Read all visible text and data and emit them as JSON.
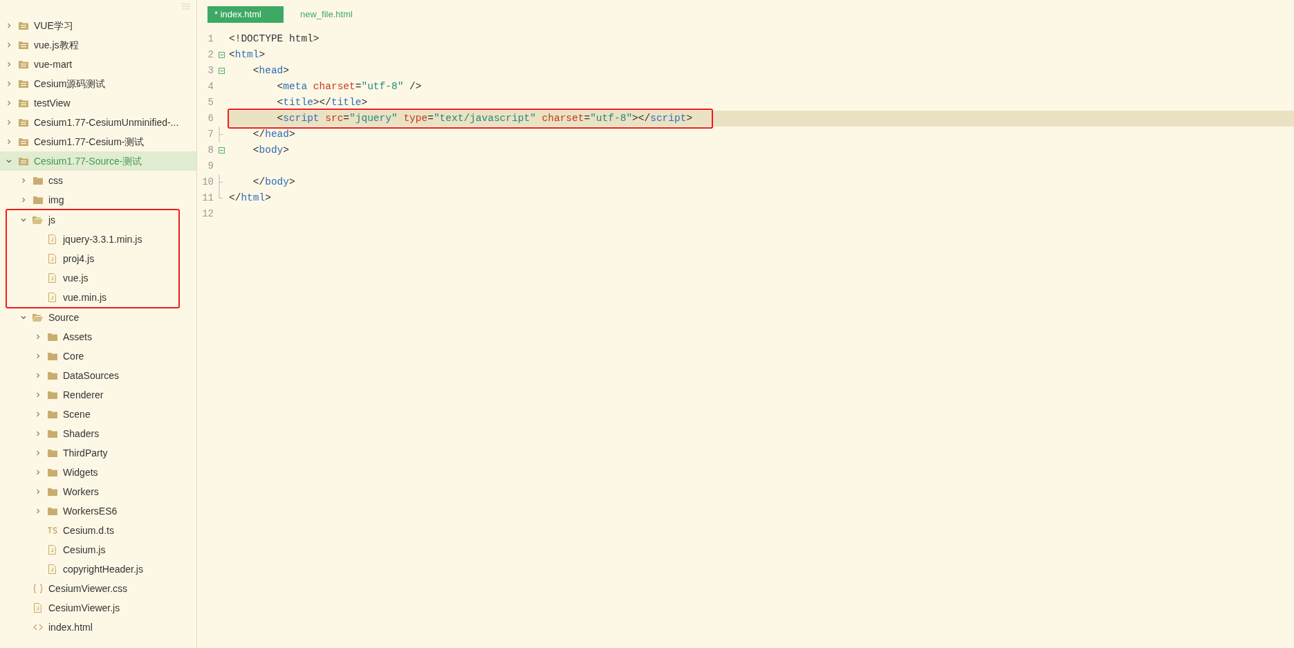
{
  "sidebar": {
    "tree": [
      {
        "label": "VUE学习",
        "kind": "project",
        "expanded": false,
        "selected": false
      },
      {
        "label": "vue.js教程",
        "kind": "project",
        "expanded": false,
        "selected": false
      },
      {
        "label": "vue-mart",
        "kind": "project",
        "expanded": false,
        "selected": false
      },
      {
        "label": "Cesium源码测试",
        "kind": "project",
        "expanded": false,
        "selected": false
      },
      {
        "label": "testView",
        "kind": "project",
        "expanded": false,
        "selected": false
      },
      {
        "label": "Cesium1.77-CesiumUnminified-...",
        "kind": "project",
        "expanded": false,
        "selected": false
      },
      {
        "label": "Cesium1.77-Cesium-测试",
        "kind": "project",
        "expanded": false,
        "selected": false
      },
      {
        "label": "Cesium1.77-Source-测试",
        "kind": "project",
        "expanded": true,
        "selected": true,
        "children": [
          {
            "label": "css",
            "kind": "folder",
            "expanded": false,
            "selected": false
          },
          {
            "label": "img",
            "kind": "folder",
            "expanded": false,
            "selected": false
          },
          {
            "label": "js",
            "kind": "folder",
            "expanded": true,
            "selected": false,
            "boxed": true,
            "children": [
              {
                "label": "jquery-3.3.1.min.js",
                "kind": "js",
                "selected": false
              },
              {
                "label": "proj4.js",
                "kind": "js",
                "selected": false
              },
              {
                "label": "vue.js",
                "kind": "js",
                "selected": false
              },
              {
                "label": "vue.min.js",
                "kind": "js",
                "selected": false
              }
            ]
          },
          {
            "label": "Source",
            "kind": "folder",
            "expanded": true,
            "selected": false,
            "children": [
              {
                "label": "Assets",
                "kind": "folder",
                "expanded": false,
                "selected": false
              },
              {
                "label": "Core",
                "kind": "folder",
                "expanded": false,
                "selected": false
              },
              {
                "label": "DataSources",
                "kind": "folder",
                "expanded": false,
                "selected": false
              },
              {
                "label": "Renderer",
                "kind": "folder",
                "expanded": false,
                "selected": false
              },
              {
                "label": "Scene",
                "kind": "folder",
                "expanded": false,
                "selected": false
              },
              {
                "label": "Shaders",
                "kind": "folder",
                "expanded": false,
                "selected": false
              },
              {
                "label": "ThirdParty",
                "kind": "folder",
                "expanded": false,
                "selected": false
              },
              {
                "label": "Widgets",
                "kind": "folder",
                "expanded": false,
                "selected": false
              },
              {
                "label": "Workers",
                "kind": "folder",
                "expanded": false,
                "selected": false
              },
              {
                "label": "WorkersES6",
                "kind": "folder",
                "expanded": false,
                "selected": false
              },
              {
                "label": "Cesium.d.ts",
                "kind": "ts",
                "selected": false
              },
              {
                "label": "Cesium.js",
                "kind": "js",
                "selected": false
              },
              {
                "label": "copyrightHeader.js",
                "kind": "js",
                "selected": false
              }
            ]
          },
          {
            "label": "CesiumViewer.css",
            "kind": "css",
            "selected": false
          },
          {
            "label": "CesiumViewer.js",
            "kind": "js",
            "selected": false
          },
          {
            "label": "index.html",
            "kind": "html",
            "selected": false
          }
        ]
      }
    ]
  },
  "tabs": [
    {
      "label": "* index.html",
      "selected": true
    },
    {
      "label": "new_file.html",
      "selected": false
    }
  ],
  "editor": {
    "lines": [
      {
        "number": "1",
        "tokens": [
          {
            "kind": "punct",
            "text": "<!DOCTYPE html>"
          }
        ]
      },
      {
        "number": "2",
        "fold_start": true,
        "tokens": [
          {
            "kind": "punct",
            "text": "<"
          },
          {
            "kind": "tag",
            "text": "html"
          },
          {
            "kind": "punct",
            "text": ">"
          }
        ]
      },
      {
        "number": "3",
        "fold_start": true,
        "tokens": [
          {
            "kind": "punct",
            "text": "    <"
          },
          {
            "kind": "tag",
            "text": "head"
          },
          {
            "kind": "punct",
            "text": ">"
          }
        ]
      },
      {
        "number": "4",
        "tokens": [
          {
            "kind": "punct",
            "text": "        <"
          },
          {
            "kind": "tag",
            "text": "meta"
          },
          {
            "kind": "attr",
            "text": " charset"
          },
          {
            "kind": "punct",
            "text": "="
          },
          {
            "kind": "string",
            "text": "\"utf-8\""
          },
          {
            "kind": "punct",
            "text": " />"
          }
        ]
      },
      {
        "number": "5",
        "tokens": [
          {
            "kind": "punct",
            "text": "        <"
          },
          {
            "kind": "tag",
            "text": "title"
          },
          {
            "kind": "punct",
            "text": "></"
          },
          {
            "kind": "tag",
            "text": "title"
          },
          {
            "kind": "punct",
            "text": ">"
          }
        ]
      },
      {
        "number": "6",
        "current": true,
        "boxed": true,
        "tokens": [
          {
            "kind": "punct",
            "text": "        <"
          },
          {
            "kind": "tag",
            "text": "script"
          },
          {
            "kind": "attr",
            "text": " src"
          },
          {
            "kind": "punct",
            "text": "="
          },
          {
            "kind": "string",
            "text": "\"jquery\""
          },
          {
            "kind": "attr",
            "text": " type"
          },
          {
            "kind": "punct",
            "text": "="
          },
          {
            "kind": "string",
            "text": "\"text/javascript\""
          },
          {
            "kind": "attr",
            "text": " charset"
          },
          {
            "kind": "punct",
            "text": "="
          },
          {
            "kind": "string",
            "text": "\"utf-8\""
          },
          {
            "kind": "punct",
            "text": "></"
          },
          {
            "kind": "tag",
            "text": "script"
          },
          {
            "kind": "punct",
            "text": ">"
          }
        ]
      },
      {
        "number": "7",
        "fold_end": true,
        "tokens": [
          {
            "kind": "punct",
            "text": "    </"
          },
          {
            "kind": "tag",
            "text": "head"
          },
          {
            "kind": "punct",
            "text": ">"
          }
        ]
      },
      {
        "number": "8",
        "fold_start": true,
        "tokens": [
          {
            "kind": "punct",
            "text": "    <"
          },
          {
            "kind": "tag",
            "text": "body"
          },
          {
            "kind": "punct",
            "text": ">"
          }
        ]
      },
      {
        "number": "9"
      },
      {
        "number": "10",
        "fold_end": true,
        "tokens": [
          {
            "kind": "punct",
            "text": "    </"
          },
          {
            "kind": "tag",
            "text": "body"
          },
          {
            "kind": "punct",
            "text": ">"
          }
        ]
      },
      {
        "number": "11",
        "fold_end": true,
        "tokens": [
          {
            "kind": "punct",
            "text": "</"
          },
          {
            "kind": "tag",
            "text": "html"
          },
          {
            "kind": "punct",
            "text": ">"
          }
        ]
      },
      {
        "number": "12"
      }
    ]
  }
}
